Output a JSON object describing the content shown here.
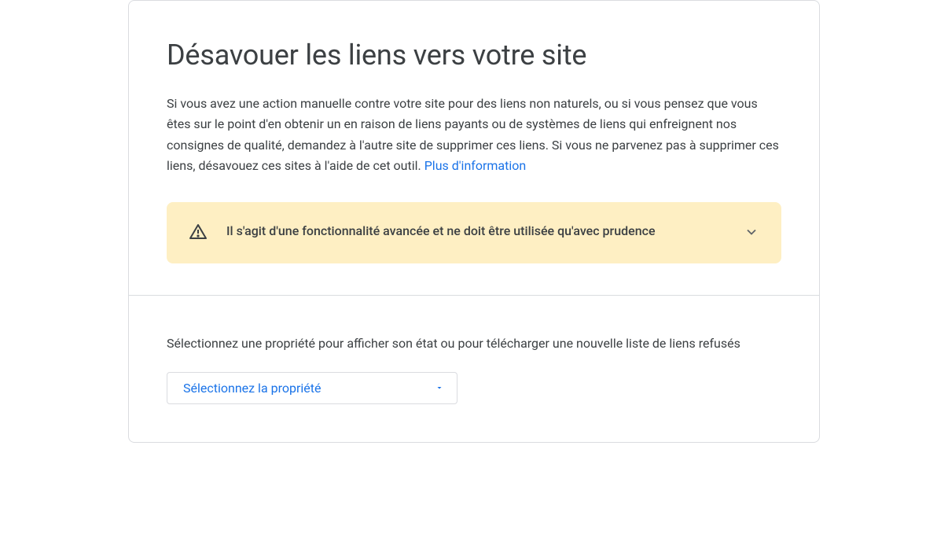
{
  "page": {
    "title": "Désavouer les liens vers votre site",
    "description_text": "Si vous avez une action manuelle contre votre site pour des liens non naturels, ou si vous pensez que vous êtes sur le point d'en obtenir un en raison de liens payants ou de systèmes de liens qui enfreignent nos consignes de qualité, demandez à l'autre site de supprimer ces liens. Si vous ne parvenez pas à supprimer ces liens, désavouez ces sites à l'aide de cet outil. ",
    "more_info_link": "Plus d'information"
  },
  "warning": {
    "text": "Il s'agit d'une fonctionnalité avancée et ne doit être utilisée qu'avec prudence"
  },
  "property_section": {
    "instruction": "Sélectionnez une propriété pour afficher son état ou pour télécharger une nouvelle liste de liens refusés",
    "select_label": "Sélectionnez la propriété"
  }
}
